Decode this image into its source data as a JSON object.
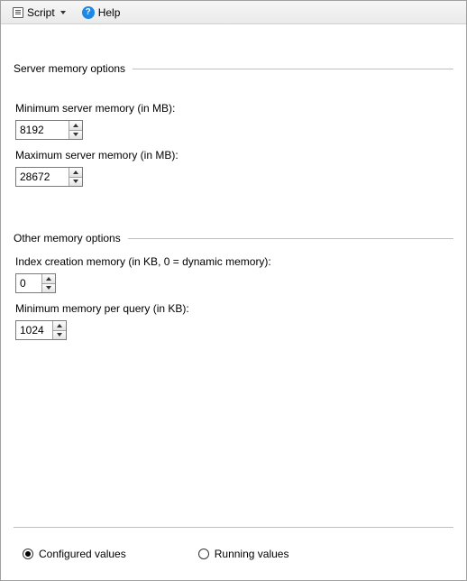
{
  "toolbar": {
    "script_label": "Script",
    "help_label": "Help"
  },
  "group1": {
    "title": "Server memory options",
    "min_label": "Minimum server memory (in MB):",
    "min_value": "8192",
    "max_label": "Maximum server memory (in MB):",
    "max_value": "28672"
  },
  "group2": {
    "title": "Other memory options",
    "index_label": "Index creation memory (in KB, 0 = dynamic memory):",
    "index_value": "0",
    "minq_label": "Minimum memory per query (in KB):",
    "minq_value": "1024"
  },
  "footer": {
    "configured_label": "Configured values",
    "running_label": "Running values"
  }
}
